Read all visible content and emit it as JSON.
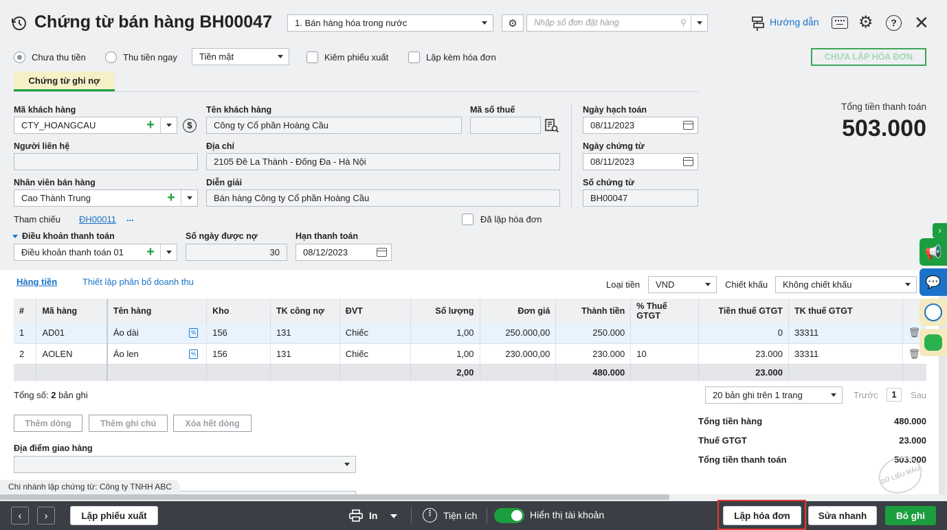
{
  "header": {
    "title": "Chứng từ bán hàng BH00047",
    "sale_type": "1. Bán hàng hóa trong nước",
    "order_search_placeholder": "Nhập số đơn đặt hàng",
    "guide_label": "Hướng dẫn"
  },
  "payment": {
    "unpaid_label": "Chưa thu tiền",
    "paid_label": "Thu tiền ngay",
    "method": "Tiền mặt",
    "export_slip_label": "Kiêm phiếu xuất",
    "with_invoice_label": "Lập kèm hóa đơn",
    "invoice_status": "CHƯA LẬP HÓA ĐƠN"
  },
  "tab_label": "Chứng từ ghi nợ",
  "form": {
    "customer_code_label": "Mã khách hàng",
    "customer_code": "CTY_HOANGCAU",
    "customer_name_label": "Tên khách hàng",
    "customer_name": "Công ty Cổ phần Hoàng Cầu",
    "tax_code_label": "Mã số thuế",
    "tax_code": "",
    "contact_label": "Người liên hệ",
    "contact": "",
    "address_label": "Địa chỉ",
    "address": "2105 Đê La Thành - Đống Đa - Hà Nội",
    "salesperson_label": "Nhân viên bán hàng",
    "salesperson": "Cao Thành Trung",
    "description_label": "Diễn giải",
    "description": "Bán hàng Công ty Cổ phần Hoàng Cầu",
    "reference_label": "Tham chiếu",
    "reference": "ĐH00011",
    "reference_more": "...",
    "invoiced_label": "Đã lập hóa đơn",
    "terms_label": "Điều khoản thanh toán",
    "terms": "Điều khoản thanh toán 01",
    "credit_days_label": "Số ngày được nợ",
    "credit_days": "30",
    "due_date_label": "Hạn thanh toán",
    "due_date": "08/12/2023",
    "posting_date_label": "Ngày hạch toán",
    "posting_date": "08/11/2023",
    "voucher_date_label": "Ngày chứng từ",
    "voucher_date": "08/11/2023",
    "voucher_no_label": "Số chứng từ",
    "voucher_no": "BH00047"
  },
  "total_payment_label": "Tổng tiền thanh toán",
  "total_payment": "503.000",
  "detail_tabs": {
    "goods": "Hàng tiền",
    "revenue": "Thiết lập phân bổ doanh thu"
  },
  "currency_label": "Loại tiền",
  "currency": "VND",
  "discount_label": "Chiết khấu",
  "discount": "Không chiết khấu",
  "table": {
    "headers": [
      "#",
      "Mã hàng",
      "Tên hàng",
      "Kho",
      "TK công nợ",
      "ĐVT",
      "Số lượng",
      "Đơn giá",
      "Thành tiền",
      "% Thuế GTGT",
      "Tiền thuế GTGT",
      "TK thuế GTGT"
    ],
    "rows": [
      [
        "1",
        "AD01",
        "Áo dài",
        "156",
        "131",
        "Chiếc",
        "1,00",
        "250.000,00",
        "250.000",
        "",
        "0",
        "33311"
      ],
      [
        "2",
        "AOLEN",
        "Áo len",
        "156",
        "131",
        "Chiếc",
        "1,00",
        "230.000,00",
        "230.000",
        "10",
        "23.000",
        "33311"
      ]
    ],
    "footer": {
      "qty": "2,00",
      "amount": "480.000",
      "vat": "23.000"
    }
  },
  "record_count_prefix": "Tổng số:",
  "record_count": "2",
  "record_count_suffix": "bản ghi",
  "pager": {
    "size": "20 bản ghi trên 1 trang",
    "prev": "Trước",
    "page": "1",
    "next": "Sau"
  },
  "row_buttons": {
    "add_row": "Thêm dòng",
    "add_note": "Thêm ghi chú",
    "clear_rows": "Xóa hết dòng"
  },
  "delivery_label": "Địa điểm giao hàng",
  "branch_note": "Chi nhánh lập chứng từ: Công ty TNHH ABC",
  "summary": {
    "goods_label": "Tổng tiền hàng",
    "goods": "480.000",
    "vat_label": "Thuế GTGT",
    "vat": "23.000",
    "total_label": "Tổng tiền thanh toán",
    "total": "503.000"
  },
  "watermark": "DỮ LIỆU MẪU",
  "footer": {
    "export_slip": "Lập phiếu xuất",
    "print": "In",
    "utilities": "Tiện ích",
    "show_accounts": "Hiển thị tài khoản",
    "create_invoice": "Lập hóa đơn",
    "quick_edit": "Sửa nhanh",
    "save": "Bỏ ghi"
  },
  "colors": {
    "accent_green": "#1b9e3e",
    "link_blue": "#1a73c8",
    "footer_bg": "#3b3e44",
    "highlight_red": "#e53935"
  }
}
